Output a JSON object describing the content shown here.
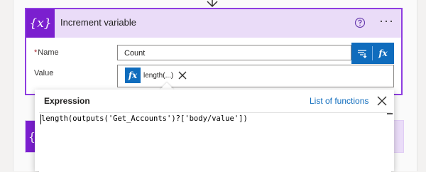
{
  "card": {
    "icon_text": "{x}",
    "title": "Increment variable",
    "help_icon": "help-circle-icon",
    "more_icon": "ellipsis-icon",
    "more_text": "···"
  },
  "fields": {
    "name_required_mark": "*",
    "name_label": "Name",
    "name_value": "Count",
    "value_label": "Value",
    "token_label": "length(...)"
  },
  "dynamic_content": {
    "icon": "dynamic-content-icon",
    "fx_text": "fx"
  },
  "under_card": {
    "icon_text": "{"
  },
  "expression_panel": {
    "title": "Expression",
    "link": "List of functions",
    "close_icon": "close-icon",
    "expression": "length(outputs('Get_Accounts')?['body/value'])"
  },
  "colors": {
    "accent_purple": "#7b1fcf",
    "header_lavender": "#eadcf8",
    "card_border": "#8e3de0",
    "primary_blue": "#0f6cbd"
  }
}
